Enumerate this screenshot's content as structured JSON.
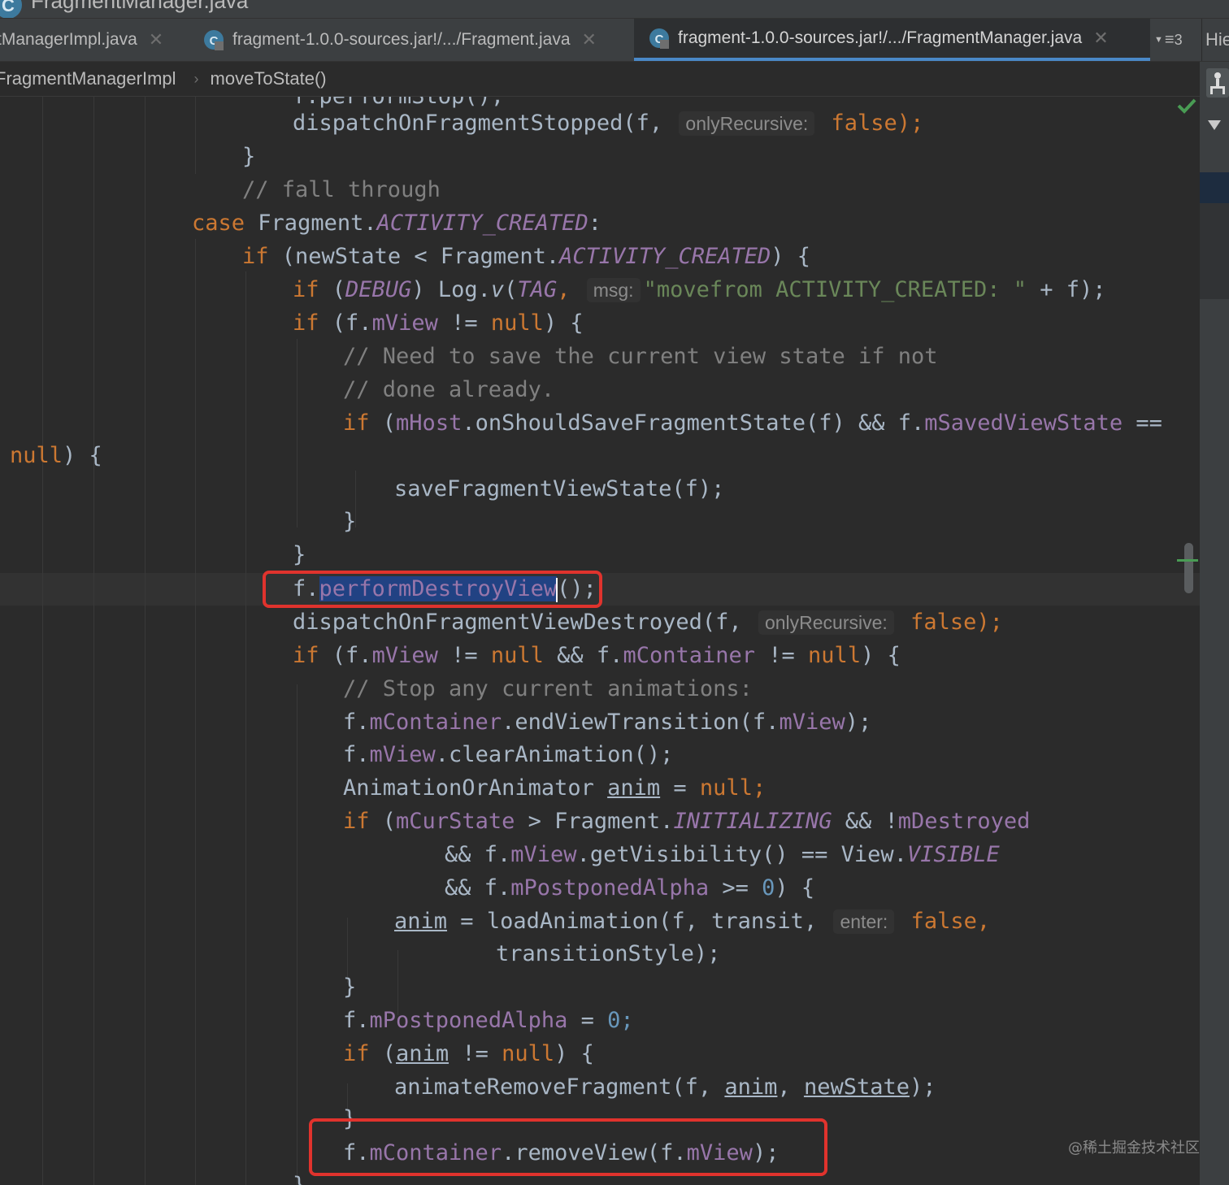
{
  "window": {
    "title": "FragmentManager.java"
  },
  "tabs": [
    {
      "label": "tManagerImpl.java",
      "active": false
    },
    {
      "label": "fragment-1.0.0-sources.jar!/.../Fragment.java",
      "active": false
    },
    {
      "label": "fragment-1.0.0-sources.jar!/.../FragmentManager.java",
      "active": true
    }
  ],
  "tab_overflow_count": "3",
  "hierarchy_label": "Hie",
  "breadcrumb": [
    "FragmentManagerImpl",
    "moveToState()"
  ],
  "hints": {
    "only_recursive": "onlyRecursive:",
    "msg": "msg:",
    "enter": "enter:"
  },
  "code": {
    "partial_top": "f.performStop();",
    "dispatch_stopped": "dispatchOnFragmentStopped(f,",
    "false_tail": "false);",
    "false_comma": "false,",
    "close_brace": "}",
    "fall_through": "// fall through",
    "case_kw": "case",
    "case_expr": "Fragment.",
    "activity_created": "ACTIVITY_CREATED",
    "colon": ":",
    "if_kw": "if",
    "new_state_open": "(newState < Fragment.",
    "paren_brace": ") {",
    "debug_open": "(",
    "debug": "DEBUG",
    "log_v": ") Log.",
    "v": "v",
    "tag_open": "(",
    "tag": "TAG",
    "comma": ",",
    "movefrom": "\"movefrom ACTIVITY_CREATED: \"",
    "plus_f": " + f);",
    "fview_open": "(f.",
    "mview": "mView",
    "neq": " != ",
    "null": "null",
    "null_semi": "null;",
    "need_save": "// Need to save the current view state if not",
    "done_already": "// done already.",
    "mhost": "mHost",
    "on_should_save": ".onShouldSaveFragmentState(f) && f.",
    "msaved_view_state": "mSavedViewState",
    "eqeq": " ==",
    "null_brace_tail": ") {",
    "save_fragment": "saveFragmentViewState(f);",
    "f_dot": "f.",
    "perform_destroy_view": "performDestroyView",
    "perform_tail": "();",
    "dispatch_view_destroyed": "dispatchOnFragmentViewDestroyed(f,",
    "and_f": " && f.",
    "mcontainer": "mContainer",
    "stop_anim": "// Stop any current animations:",
    "end_view_transition": ".endViewTransition(f.",
    "close_paren_semi": ");",
    "clear_animation": ".clearAnimation();",
    "anim_or_animator": "AnimationOrAnimator ",
    "anim": "anim",
    "assign": " = ",
    "cur_state_open": "(",
    "mcurstate": "mCurState",
    "gt_fragment": " > Fragment.",
    "initializing": "INITIALIZING",
    "and_not": " && !",
    "mdestroyed": "mDestroyed",
    "and_f2": "&& f.",
    "get_visibility": ".getVisibility() == View.",
    "visible": "VISIBLE",
    "mpostponed_alpha": "mPostponedAlpha",
    "gte": " >= ",
    "zero": "0",
    "zero_semi": "0;",
    "load_animation": "loadAnimation(f, transit,",
    "transition_style": "transitionStyle);",
    "animate_remove": "animateRemoveFragment(f, ",
    "comma_sp": ", ",
    "new_state": "newState",
    "remove_view": ".removeView(f.",
    "last_brace": "}"
  },
  "watermark": "@稀土掘金技术社区",
  "colors": {
    "background": "#2b2b2b",
    "keyword": "#cc7832",
    "comment": "#808080",
    "field": "#9876aa",
    "string": "#6a8759",
    "number": "#6897bb",
    "text": "#a9b7c6",
    "highlight_box": "#e0332d",
    "selection": "#214283"
  }
}
